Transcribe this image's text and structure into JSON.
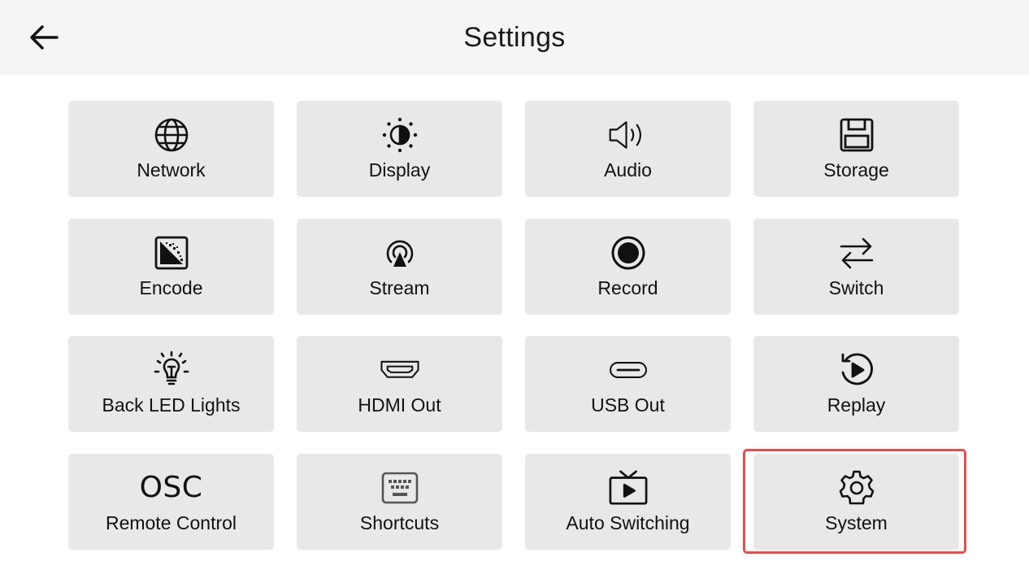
{
  "header": {
    "title": "Settings",
    "back_icon": "arrow-left-icon"
  },
  "tiles": [
    {
      "label": "Network",
      "icon": "globe-icon"
    },
    {
      "label": "Display",
      "icon": "brightness-icon"
    },
    {
      "label": "Audio",
      "icon": "speaker-icon"
    },
    {
      "label": "Storage",
      "icon": "floppy-disk-icon"
    },
    {
      "label": "Encode",
      "icon": "encode-gradient-icon"
    },
    {
      "label": "Stream",
      "icon": "broadcast-icon"
    },
    {
      "label": "Record",
      "icon": "record-icon"
    },
    {
      "label": "Switch",
      "icon": "swap-arrows-icon"
    },
    {
      "label": "Back LED Lights",
      "icon": "lightbulb-icon"
    },
    {
      "label": "HDMI Out",
      "icon": "hdmi-port-icon"
    },
    {
      "label": "USB Out",
      "icon": "usb-c-port-icon"
    },
    {
      "label": "Replay",
      "icon": "replay-icon"
    },
    {
      "label": "Remote Control",
      "icon_text": "OSC"
    },
    {
      "label": "Shortcuts",
      "icon": "keyboard-icon"
    },
    {
      "label": "Auto Switching",
      "icon": "tv-play-icon"
    },
    {
      "label": "System",
      "icon": "gear-icon",
      "selected": true
    }
  ],
  "colors": {
    "header_bg": "#f5f5f5",
    "tile_bg": "#e8e8e8",
    "selection_outline": "#e05050"
  }
}
